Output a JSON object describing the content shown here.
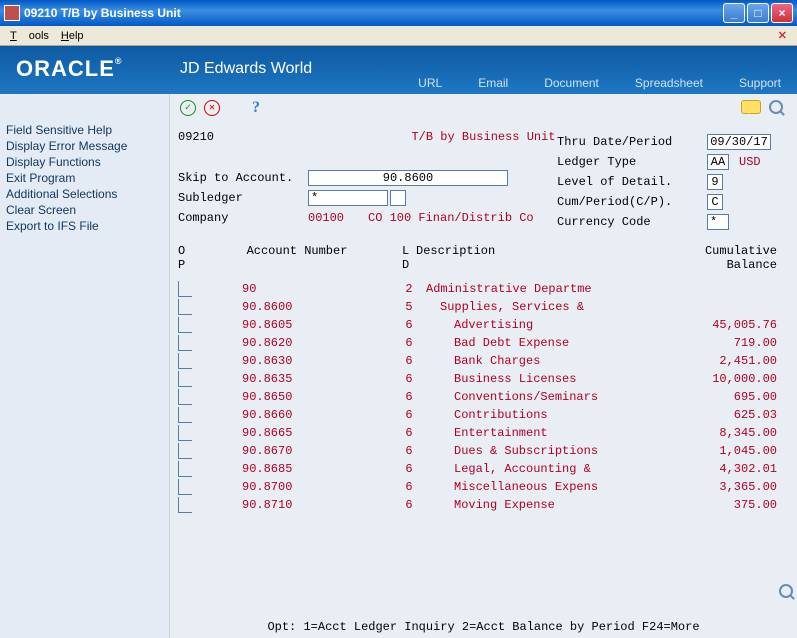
{
  "window": {
    "title": "09210   T/B by Business Unit"
  },
  "menu": {
    "tools": "Tools",
    "help": "Help"
  },
  "banner": {
    "oracle": "ORACLE",
    "jd": "JD Edwards World",
    "links": {
      "url": "URL",
      "email": "Email",
      "document": "Document",
      "spreadsheet": "Spreadsheet",
      "support": "Support"
    }
  },
  "sidebar": {
    "items": [
      "Field Sensitive Help",
      "Display Error Message",
      "Display Functions",
      "Exit Program",
      "Additional Selections",
      "Clear Screen",
      "Export to IFS File"
    ]
  },
  "form": {
    "screen_id": "09210",
    "title": "T/B by Business Unit",
    "labels": {
      "skip": "Skip to Account.",
      "subledger": "Subledger",
      "company": "Company",
      "thru": "Thru Date/Period",
      "ledger": "Ledger Type",
      "lod": "Level of Detail.",
      "cumperiod": "Cum/Period(C/P).",
      "currency": "Currency Code"
    },
    "skip_value": "90.8600",
    "subledger_value": "*",
    "subledger_type": "",
    "company_code": "00100",
    "company_desc": "CO 100 Finan/Distrib Co",
    "thru_value": "09/30/17",
    "ledger_value": "AA",
    "ledger_curr": "USD",
    "lod_value": "9",
    "cump_value": "C",
    "currency_value": "*"
  },
  "table": {
    "headers": {
      "o": "O",
      "p": "P",
      "acct": "Account Number",
      "l": "L",
      "d": "D",
      "desc": "Description",
      "cum": "Cumulative",
      "bal": "Balance"
    },
    "rows": [
      {
        "acct": "90",
        "ld": "2",
        "desc": "Administrative Departme",
        "desc_indent": 0,
        "bal": ""
      },
      {
        "acct": "90.8600",
        "ld": "5",
        "desc": "Supplies, Services &",
        "desc_indent": 1,
        "bal": ""
      },
      {
        "acct": "90.8605",
        "ld": "6",
        "desc": "Advertising",
        "desc_indent": 2,
        "bal": "45,005.76"
      },
      {
        "acct": "90.8620",
        "ld": "6",
        "desc": "Bad Debt Expense",
        "desc_indent": 2,
        "bal": "719.00"
      },
      {
        "acct": "90.8630",
        "ld": "6",
        "desc": "Bank Charges",
        "desc_indent": 2,
        "bal": "2,451.00"
      },
      {
        "acct": "90.8635",
        "ld": "6",
        "desc": "Business Licenses",
        "desc_indent": 2,
        "bal": "10,000.00"
      },
      {
        "acct": "90.8650",
        "ld": "6",
        "desc": "Conventions/Seminars",
        "desc_indent": 2,
        "bal": "695.00"
      },
      {
        "acct": "90.8660",
        "ld": "6",
        "desc": "Contributions",
        "desc_indent": 2,
        "bal": "625.03"
      },
      {
        "acct": "90.8665",
        "ld": "6",
        "desc": "Entertainment",
        "desc_indent": 2,
        "bal": "8,345.00"
      },
      {
        "acct": "90.8670",
        "ld": "6",
        "desc": "Dues & Subscriptions",
        "desc_indent": 2,
        "bal": "1,045.00"
      },
      {
        "acct": "90.8685",
        "ld": "6",
        "desc": "Legal, Accounting &",
        "desc_indent": 2,
        "bal": "4,302.01"
      },
      {
        "acct": "90.8700",
        "ld": "6",
        "desc": "Miscellaneous Expens",
        "desc_indent": 2,
        "bal": "3,365.00"
      },
      {
        "acct": "90.8710",
        "ld": "6",
        "desc": "Moving Expense",
        "desc_indent": 2,
        "bal": "375.00"
      }
    ]
  },
  "footer": "Opt: 1=Acct Ledger Inquiry   2=Acct Balance by Period    F24=More"
}
